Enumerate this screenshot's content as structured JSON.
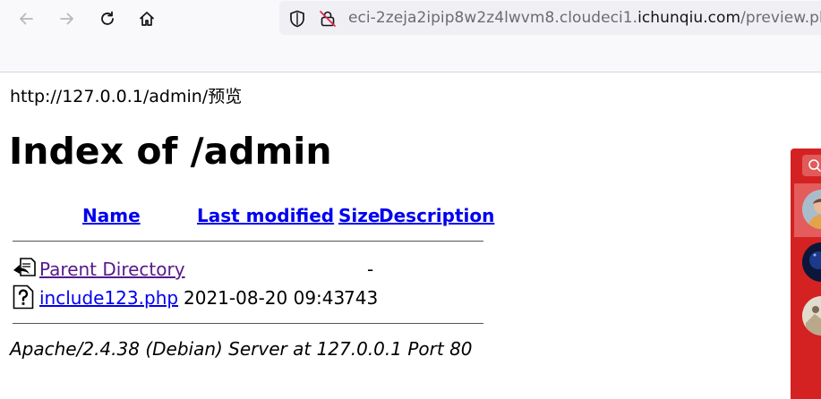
{
  "browser": {
    "url_prefix": "eci-2zeja2ipip8w2z4lwvm8.cloudeci1.",
    "url_domain": "ichunqiu.com",
    "url_path": "/preview.php"
  },
  "page": {
    "preview_line": "http://127.0.0.1/admin/预览",
    "title": "Index of /admin",
    "columns": {
      "name": "Name",
      "last_modified": "Last modified",
      "size": "Size",
      "description": "Description"
    },
    "rows": [
      {
        "icon": "back-folder-icon",
        "name": "Parent Directory",
        "modified": "",
        "size": "-"
      },
      {
        "icon": "unknown-file-icon",
        "name": "include123.php",
        "modified": "2021-08-20 09:43",
        "size": "743"
      }
    ],
    "address": "Apache/2.4.38 (Debian) Server at 127.0.0.1 Port 80"
  },
  "side_widget": {
    "icons": [
      "search-icon",
      "avatar",
      "avatar",
      "avatar"
    ]
  },
  "colors": {
    "link": "#0000ee",
    "visited_link": "#551a8b",
    "widget_red": "#d42222",
    "toolbar_bg": "#f9f9fb",
    "urlbar_bg": "#f0f0f4"
  }
}
